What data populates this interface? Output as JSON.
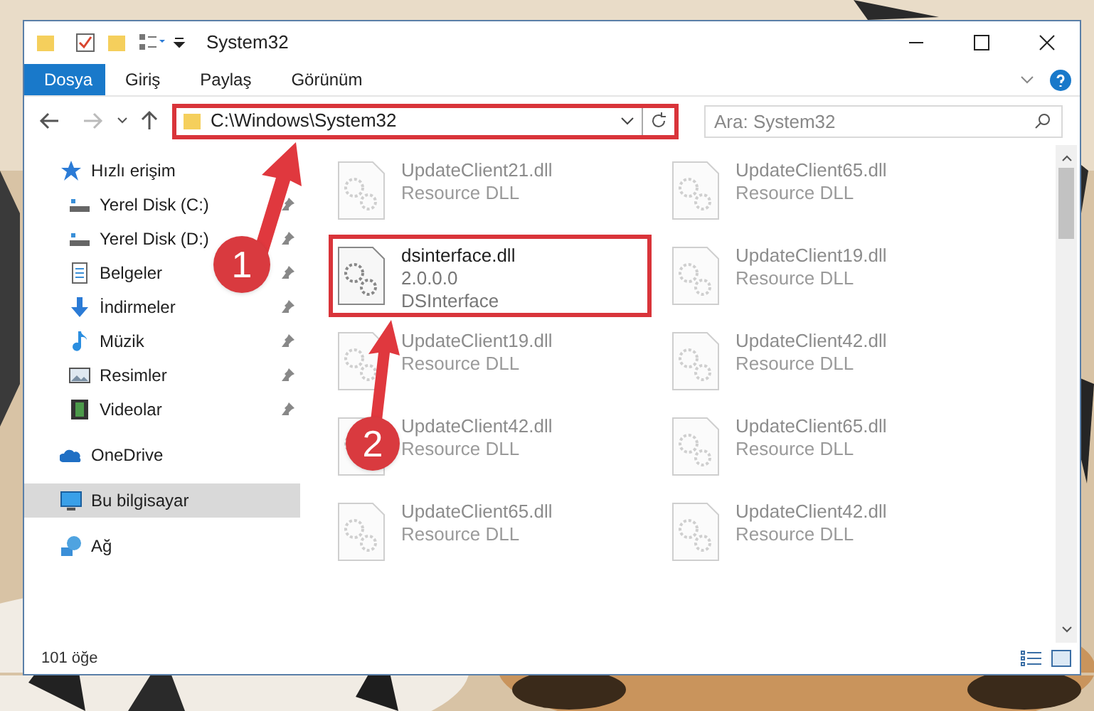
{
  "window": {
    "title": "System32"
  },
  "ribbon_tabs": [
    {
      "label": "Dosya",
      "selected": true
    },
    {
      "label": "Giriş",
      "selected": false
    },
    {
      "label": "Paylaş",
      "selected": false
    },
    {
      "label": "Görünüm",
      "selected": false
    }
  ],
  "address": {
    "path": "C:\\Windows\\System32",
    "highlighted": true
  },
  "search": {
    "placeholder": "Ara: System32"
  },
  "sidebar": {
    "items": [
      {
        "label": "Hızlı erişim",
        "kind": "star",
        "selected": false,
        "pinned": false,
        "children": [
          {
            "label": "Yerel Disk (C:)",
            "kind": "drive",
            "selected": false,
            "pinned": true
          },
          {
            "label": "Yerel Disk (D:)",
            "kind": "drive",
            "selected": false,
            "pinned": true
          },
          {
            "label": "Belgeler",
            "kind": "document",
            "selected": false,
            "pinned": true
          },
          {
            "label": "İndirmeler",
            "kind": "download",
            "selected": false,
            "pinned": true
          },
          {
            "label": "Müzik",
            "kind": "music",
            "selected": false,
            "pinned": true
          },
          {
            "label": "Resimler",
            "kind": "pictures",
            "selected": false,
            "pinned": true
          },
          {
            "label": "Videolar",
            "kind": "video",
            "selected": false,
            "pinned": true
          }
        ]
      },
      {
        "label": "OneDrive",
        "kind": "cloud",
        "selected": false,
        "pinned": false
      },
      {
        "label": "Bu bilgisayar",
        "kind": "computer",
        "selected": true,
        "pinned": false
      },
      {
        "label": "Ağ",
        "kind": "network",
        "selected": false,
        "pinned": false
      }
    ]
  },
  "files": [
    {
      "name": "UpdateClient21.dll",
      "lines": [
        "Resource DLL"
      ],
      "faded": true,
      "highlighted": false
    },
    {
      "name": "UpdateClient65.dll",
      "lines": [
        "Resource DLL"
      ],
      "faded": true,
      "highlighted": false
    },
    {
      "name": "dsinterface.dll",
      "lines": [
        "2.0.0.0",
        "DSInterface"
      ],
      "faded": false,
      "highlighted": true
    },
    {
      "name": "UpdateClient19.dll",
      "lines": [
        "Resource DLL"
      ],
      "faded": true,
      "highlighted": false
    },
    {
      "name": "UpdateClient19.dll",
      "lines": [
        "Resource DLL"
      ],
      "faded": true,
      "highlighted": false
    },
    {
      "name": "UpdateClient42.dll",
      "lines": [
        "Resource DLL"
      ],
      "faded": true,
      "highlighted": false
    },
    {
      "name": "UpdateClient42.dll",
      "lines": [
        "Resource DLL"
      ],
      "faded": true,
      "highlighted": false
    },
    {
      "name": "UpdateClient65.dll",
      "lines": [
        "Resource DLL"
      ],
      "faded": true,
      "highlighted": false
    },
    {
      "name": "UpdateClient65.dll",
      "lines": [
        "Resource DLL"
      ],
      "faded": true,
      "highlighted": false
    },
    {
      "name": "UpdateClient42.dll",
      "lines": [
        "Resource DLL"
      ],
      "faded": true,
      "highlighted": false
    }
  ],
  "status_bar": {
    "count": "101 öğe"
  },
  "annotations": [
    {
      "label": "1"
    },
    {
      "label": "2"
    }
  ]
}
